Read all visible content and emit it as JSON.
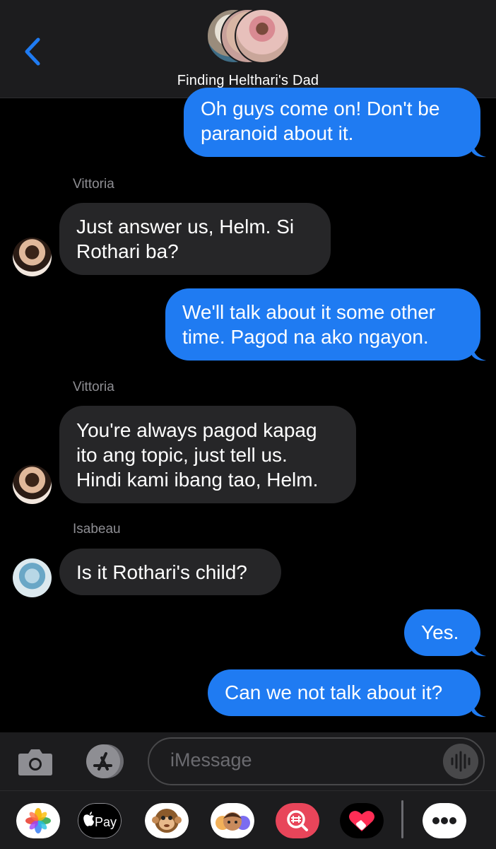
{
  "header": {
    "title": "Finding Helthari's Dad",
    "back_icon": "chevron-left-icon"
  },
  "conversation": {
    "messages": [
      {
        "direction": "outgoing",
        "lines": [
          "Oh guys come on! Don't be",
          "paranoid about it."
        ]
      },
      {
        "direction": "incoming",
        "sender": "Vittoria",
        "lines": [
          "Just answer us, Helm. Si",
          "Rothari ba?"
        ]
      },
      {
        "direction": "outgoing",
        "lines": [
          "We'll talk about it some other",
          "time. Pagod na ako ngayon."
        ]
      },
      {
        "direction": "incoming",
        "sender": "Vittoria",
        "lines": [
          "You're always pagod kapag",
          "ito ang topic, just tell us.",
          "Hindi kami ibang tao, Helm."
        ]
      },
      {
        "direction": "incoming",
        "sender": "Isabeau",
        "lines": [
          "Is it Rothari's child?"
        ]
      },
      {
        "direction": "outgoing",
        "lines": [
          "Yes."
        ]
      },
      {
        "direction": "outgoing",
        "lines": [
          "Can we not talk about it?"
        ]
      }
    ]
  },
  "compose": {
    "placeholder": "iMessage",
    "camera_icon": "camera-icon",
    "apps_icon": "app-store-icon",
    "audio_icon": "waveform-icon"
  },
  "app_drawer": {
    "items": [
      {
        "name": "photos-app-icon"
      },
      {
        "name": "apple-pay-app-icon",
        "label": "Pay"
      },
      {
        "name": "animoji-app-icon"
      },
      {
        "name": "memoji-app-icon"
      },
      {
        "name": "images-search-app-icon"
      },
      {
        "name": "digital-touch-app-icon"
      },
      {
        "name": "more-apps-icon"
      }
    ]
  },
  "colors": {
    "outgoing_bubble": "#1f7bf2",
    "incoming_bubble": "#262628",
    "background": "#000000"
  }
}
